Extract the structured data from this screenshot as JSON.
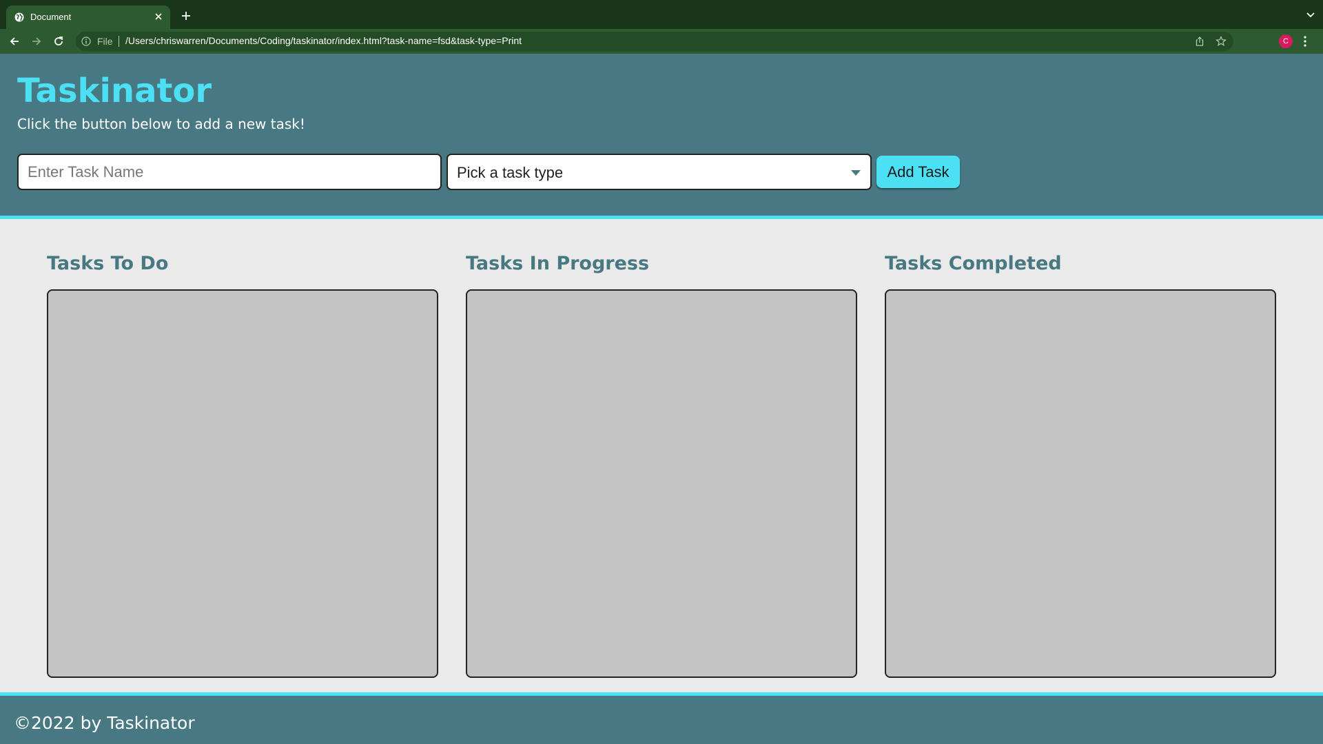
{
  "browser": {
    "tab_title": "Document",
    "address_scheme": "File",
    "url": "/Users/chriswarren/Documents/Coding/taskinator/index.html?task-name=fsd&task-type=Print",
    "profile_initial": "C"
  },
  "header": {
    "title": "Taskinator",
    "subtitle": "Click the button below to add a new task!"
  },
  "form": {
    "task_name_placeholder": "Enter Task Name",
    "task_name_value": "",
    "task_type_value": "Pick a task type",
    "add_button_label": "Add Task"
  },
  "columns": [
    {
      "title": "Tasks To Do",
      "tasks": []
    },
    {
      "title": "Tasks In Progress",
      "tasks": []
    },
    {
      "title": "Tasks Completed",
      "tasks": []
    }
  ],
  "footer": {
    "text": "©2022 by Taskinator"
  },
  "colors": {
    "header_bg": "#487982",
    "accent": "#4ce0f5",
    "page_bg": "#eaeaea",
    "column_bg": "#c4c4c4",
    "browser_frame": "#1a361a",
    "browser_toolbar": "#2d5a2f"
  },
  "icons": [
    "globe-icon",
    "close-icon",
    "plus-icon",
    "chevron-down-icon",
    "back-arrow-icon",
    "forward-arrow-icon",
    "reload-icon",
    "info-icon",
    "share-icon",
    "star-icon",
    "puzzle-icon",
    "kebab-menu-icon",
    "dropdown-caret-icon"
  ]
}
